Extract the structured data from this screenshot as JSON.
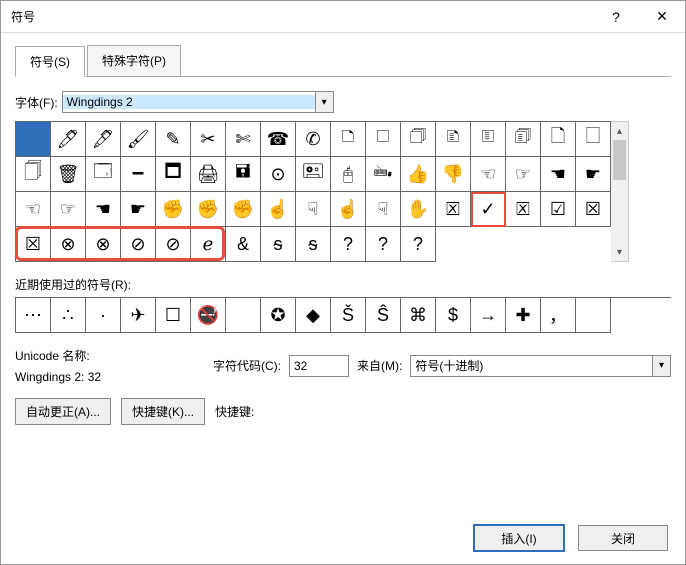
{
  "title": "符号",
  "tabs": {
    "symbols": "符号(S)",
    "special": "特殊字符(P)"
  },
  "font": {
    "label": "字体(F):",
    "value": "Wingdings 2"
  },
  "grid": [
    " ",
    "🖊",
    "🖋",
    "🖌",
    "✎",
    "✂",
    "✄",
    "☎",
    "✆",
    "🗅",
    "🗆",
    "🗇",
    "🗈",
    "🗉",
    "🗊",
    "🗋",
    "🗌",
    "🗍",
    "🗑",
    "🗔",
    "🗕",
    "🗖",
    "🖨",
    "🖬",
    "⊙",
    "🖭",
    "🖰",
    "🖦",
    "👍",
    "👎",
    "☜",
    "☞",
    "☚",
    "☛",
    "☜",
    "☞",
    "☚",
    "☛",
    "✊",
    "✊",
    "✊",
    "☝",
    "☟",
    "☝",
    "☟",
    "✋",
    "🗵",
    "✓",
    "🗵",
    "☑",
    "☒",
    "☒",
    "⊗",
    "⊗",
    "⊘",
    "⊘",
    "ℯ",
    "&",
    "ᵴ",
    "ᵴ",
    "?",
    "?",
    "?"
  ],
  "selectedIndex": 0,
  "redCellIndex": 47,
  "redBoxRow": 3,
  "recent": {
    "label": "近期使用过的符号(R):",
    "items": [
      "⋯",
      "∴",
      "·",
      "✈",
      "☐",
      "🚭",
      "",
      "✪",
      "◆",
      "Š",
      "Ŝ",
      "⌘",
      "$",
      "→",
      "✚",
      "，",
      ""
    ]
  },
  "unicode": {
    "nameLabel": "Unicode 名称:",
    "name": "Wingdings 2: 32",
    "codeLabel": "字符代码(C):",
    "code": "32",
    "fromLabel": "来自(M):",
    "from": "符号(十进制)"
  },
  "buttons": {
    "autocorrect": "自动更正(A)...",
    "shortcut": "快捷键(K)...",
    "shortcutLabel": "快捷键:",
    "insert": "插入(I)",
    "close": "关闭"
  }
}
